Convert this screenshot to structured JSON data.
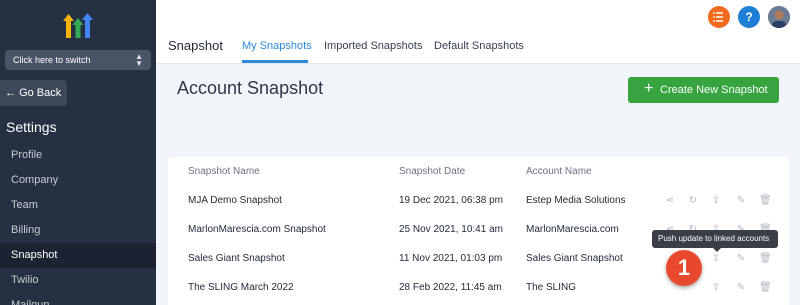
{
  "sidebar": {
    "switcher_label": "Click here to switch",
    "go_back_label": "Go Back",
    "settings_title": "Settings",
    "items": [
      {
        "label": "Profile"
      },
      {
        "label": "Company"
      },
      {
        "label": "Team"
      },
      {
        "label": "Billing"
      },
      {
        "label": "Snapshot"
      },
      {
        "label": "Twilio"
      },
      {
        "label": "Mailgun"
      }
    ],
    "active_item": "Snapshot"
  },
  "header": {
    "title": "Snapshot",
    "tabs": [
      {
        "label": "My Snapshots"
      },
      {
        "label": "Imported Snapshots"
      },
      {
        "label": "Default Snapshots"
      }
    ],
    "active_tab": "My Snapshots"
  },
  "main": {
    "page_title": "Account Snapshot",
    "create_button_label": "Create New Snapshot",
    "table": {
      "columns": [
        "Snapshot Name",
        "Snapshot Date",
        "Account Name"
      ],
      "rows": [
        {
          "name": "MJA Demo Snapshot",
          "date": "19 Dec 2021, 06:38 pm",
          "account": "Estep Media Solutions"
        },
        {
          "name": "MarlonMarescia.com Snapshot",
          "date": "25 Nov 2021, 10:41 am",
          "account": "MarlonMarescia.com"
        },
        {
          "name": "Sales Giant Snapshot",
          "date": "11 Nov 2021, 01:03 pm",
          "account": "Sales Giant Snapshot"
        },
        {
          "name": "The SLING March 2022",
          "date": "28 Feb 2022, 11:45 am",
          "account": "The SLING"
        }
      ]
    },
    "tooltip": "Push update to linked accounts",
    "step_marker": "1"
  },
  "colors": {
    "sidebar_bg": "#253042",
    "accent_blue": "#2b8ad9",
    "create_green": "#37a440",
    "marker_red": "#e8492e"
  }
}
